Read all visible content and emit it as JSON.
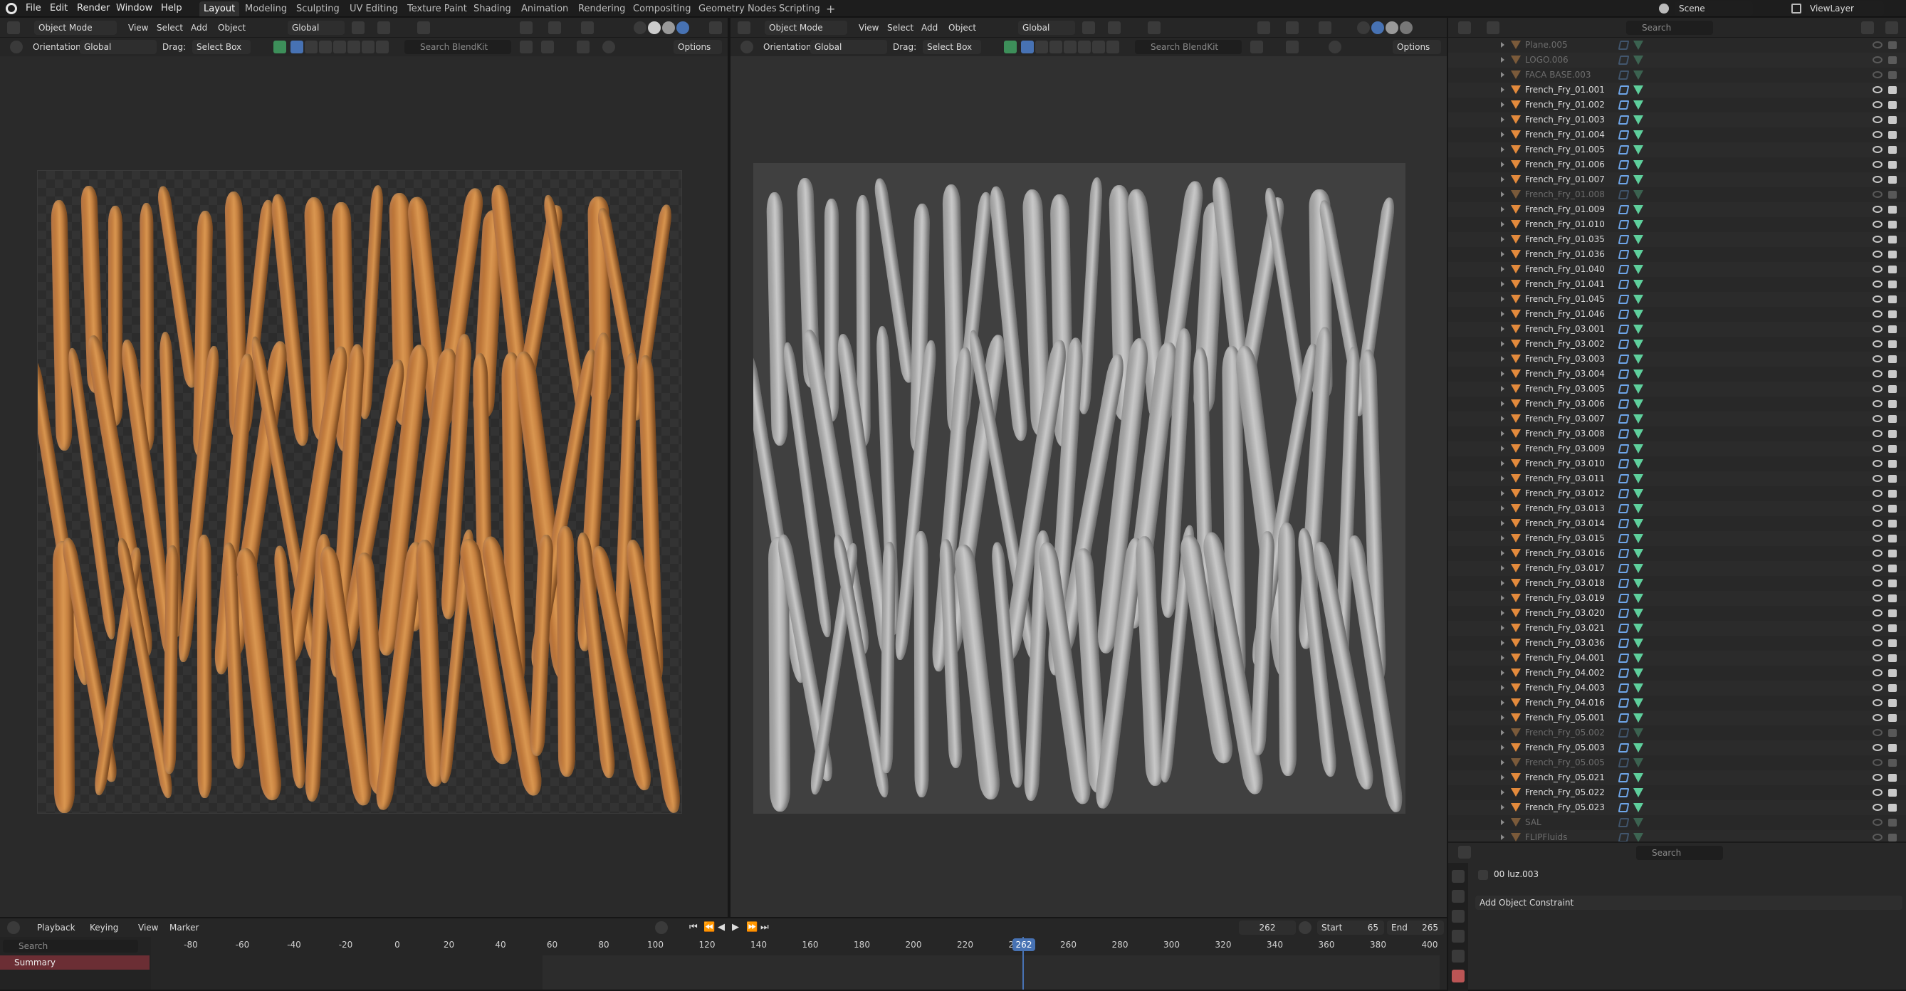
{
  "menu": [
    "File",
    "Edit",
    "Render",
    "Window",
    "Help"
  ],
  "workspaces": [
    "Layout",
    "Modeling",
    "Sculpting",
    "UV Editing",
    "Texture Paint",
    "Shading",
    "Animation",
    "Rendering",
    "Compositing",
    "Geometry Nodes",
    "Scripting"
  ],
  "active_workspace": "Layout",
  "scene": "Scene",
  "view_layer": "ViewLayer",
  "left_view": {
    "mode": "Object Mode",
    "menus": [
      "View",
      "Select",
      "Add",
      "Object"
    ],
    "transform": "Global",
    "orientation_label": "Orientation:",
    "orientation_value": "Global",
    "drag_label": "Drag:",
    "drag_value": "Select Box",
    "search_placeholder": "Search BlendKit",
    "options": "Options"
  },
  "right_view": {
    "mode": "Object Mode",
    "menus": [
      "View",
      "Select",
      "Add",
      "Object"
    ],
    "transform": "Global",
    "orientation_label": "Orientation:",
    "orientation_value": "Global",
    "drag_label": "Drag:",
    "drag_value": "Select Box",
    "search_placeholder": "Search BlendKit",
    "options": "Options"
  },
  "outliner": {
    "search_placeholder": "Search",
    "items": [
      {
        "name": "Plane.005",
        "dim": true
      },
      {
        "name": "LOGO.006",
        "dim": true
      },
      {
        "name": "FACA BASE.003",
        "dim": true
      },
      {
        "name": "French_Fry_01.001",
        "dim": false
      },
      {
        "name": "French_Fry_01.002",
        "dim": false
      },
      {
        "name": "French_Fry_01.003",
        "dim": false
      },
      {
        "name": "French_Fry_01.004",
        "dim": false
      },
      {
        "name": "French_Fry_01.005",
        "dim": false
      },
      {
        "name": "French_Fry_01.006",
        "dim": false
      },
      {
        "name": "French_Fry_01.007",
        "dim": false
      },
      {
        "name": "French_Fry_01.008",
        "dim": true
      },
      {
        "name": "French_Fry_01.009",
        "dim": false
      },
      {
        "name": "French_Fry_01.010",
        "dim": false
      },
      {
        "name": "French_Fry_01.035",
        "dim": false
      },
      {
        "name": "French_Fry_01.036",
        "dim": false
      },
      {
        "name": "French_Fry_01.040",
        "dim": false
      },
      {
        "name": "French_Fry_01.041",
        "dim": false
      },
      {
        "name": "French_Fry_01.045",
        "dim": false
      },
      {
        "name": "French_Fry_01.046",
        "dim": false
      },
      {
        "name": "French_Fry_03.001",
        "dim": false
      },
      {
        "name": "French_Fry_03.002",
        "dim": false
      },
      {
        "name": "French_Fry_03.003",
        "dim": false
      },
      {
        "name": "French_Fry_03.004",
        "dim": false
      },
      {
        "name": "French_Fry_03.005",
        "dim": false
      },
      {
        "name": "French_Fry_03.006",
        "dim": false
      },
      {
        "name": "French_Fry_03.007",
        "dim": false
      },
      {
        "name": "French_Fry_03.008",
        "dim": false
      },
      {
        "name": "French_Fry_03.009",
        "dim": false
      },
      {
        "name": "French_Fry_03.010",
        "dim": false
      },
      {
        "name": "French_Fry_03.011",
        "dim": false
      },
      {
        "name": "French_Fry_03.012",
        "dim": false
      },
      {
        "name": "French_Fry_03.013",
        "dim": false
      },
      {
        "name": "French_Fry_03.014",
        "dim": false
      },
      {
        "name": "French_Fry_03.015",
        "dim": false
      },
      {
        "name": "French_Fry_03.016",
        "dim": false
      },
      {
        "name": "French_Fry_03.017",
        "dim": false
      },
      {
        "name": "French_Fry_03.018",
        "dim": false
      },
      {
        "name": "French_Fry_03.019",
        "dim": false
      },
      {
        "name": "French_Fry_03.020",
        "dim": false
      },
      {
        "name": "French_Fry_03.021",
        "dim": false
      },
      {
        "name": "French_Fry_03.036",
        "dim": false
      },
      {
        "name": "French_Fry_04.001",
        "dim": false
      },
      {
        "name": "French_Fry_04.002",
        "dim": false
      },
      {
        "name": "French_Fry_04.003",
        "dim": false
      },
      {
        "name": "French_Fry_04.016",
        "dim": false
      },
      {
        "name": "French_Fry_05.001",
        "dim": false
      },
      {
        "name": "French_Fry_05.002",
        "dim": true
      },
      {
        "name": "French_Fry_05.003",
        "dim": false
      },
      {
        "name": "French_Fry_05.005",
        "dim": true
      },
      {
        "name": "French_Fry_05.021",
        "dim": false
      },
      {
        "name": "French_Fry_05.022",
        "dim": false
      },
      {
        "name": "French_Fry_05.023",
        "dim": false
      },
      {
        "name": "SAL",
        "dim": true
      },
      {
        "name": "FLIPFluids",
        "dim": true
      }
    ]
  },
  "properties": {
    "search_placeholder": "Search",
    "object_name": "00 luz.003",
    "add_constraint": "Add Object Constraint"
  },
  "timeline": {
    "menus": [
      "Playback",
      "Keying",
      "View",
      "Marker"
    ],
    "current_frame": "262",
    "start_label": "Start",
    "start": "65",
    "end_label": "End",
    "end": "265",
    "search_placeholder": "Search",
    "summary": "Summary",
    "ticks": [
      "-80",
      "-60",
      "-40",
      "-20",
      "0",
      "20",
      "40",
      "60",
      "80",
      "100",
      "120",
      "140",
      "160",
      "180",
      "200",
      "220",
      "240",
      "260",
      "280",
      "300",
      "320",
      "340",
      "360",
      "380",
      "400"
    ]
  },
  "colors": {
    "accent": "#4772b3",
    "fry_orange": "#c9803e",
    "fry_gray": "#b5b5b5",
    "object_icon": "#e38a3c",
    "mesh_icon": "#5ecf9c",
    "modifier_icon": "#6ea5e8",
    "playhead": "#4772b3"
  }
}
